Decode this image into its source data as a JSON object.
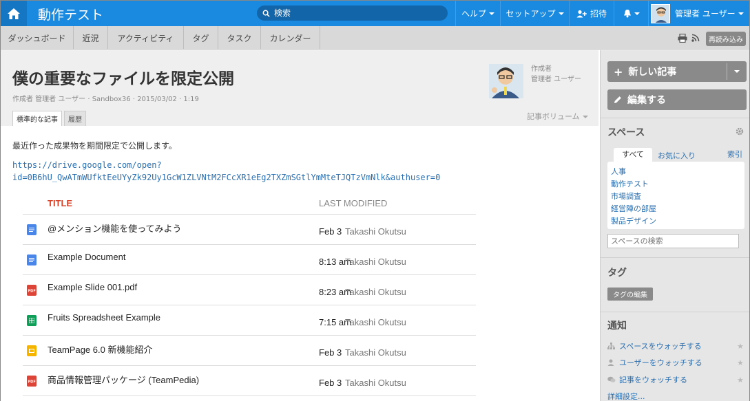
{
  "header": {
    "app_title": "動作テスト",
    "search_placeholder": "検索",
    "help": "ヘルプ",
    "setup": "セットアップ",
    "invite": "招待",
    "user": "管理者 ユーザー"
  },
  "tabs": [
    "ダッシュボード",
    "近況",
    "アクティビティ",
    "タグ",
    "タスク",
    "カレンダー"
  ],
  "reload_label": "再読み込み",
  "article": {
    "title": "僕の重要なファイルを限定公開",
    "meta": "作成者 管理者 ユーザー · Sandbox36 · 2015/03/02 · 1:19",
    "author_label": "作成者",
    "author_name": "管理者 ユーザー",
    "tab_standard": "標準的な記事",
    "tab_history": "履歴",
    "volume_label": "記事ボリューム",
    "body": "最近作った成果物を期間限定で公開します。",
    "link_line1": "https://drive.google.com/open?",
    "link_line2": "id=0B6hU_QwATmWUfktEeUYyZk92Uy1GcW1ZLVNtM2FCcXR1eEg2TXZmSGtlYmMteTJQTzVmNlk&authuser=0"
  },
  "files": {
    "col_title": "TITLE",
    "col_modified": "LAST MODIFIED",
    "rows": [
      {
        "name": "@メンション機能を使ってみよう",
        "date": "Feb 3",
        "user": "Takashi Okutsu",
        "type": "doc"
      },
      {
        "name": "Example Document",
        "date": "8:13 am",
        "user": "Takashi Okutsu",
        "type": "doc"
      },
      {
        "name": "Example Slide 001.pdf",
        "date": "8:23 am",
        "user": "Takashi Okutsu",
        "type": "pdf"
      },
      {
        "name": "Fruits Spreadsheet Example",
        "date": "7:15 am",
        "user": "Takashi Okutsu",
        "type": "sheet"
      },
      {
        "name": "TeamPage 6.0 新機能紹介",
        "date": "Feb 3",
        "user": "Takashi Okutsu",
        "type": "slides"
      },
      {
        "name": "商品情報管理パッケージ (TeamPedia)",
        "date": "Feb 3",
        "user": "Takashi Okutsu",
        "type": "pdf"
      }
    ]
  },
  "sidebar": {
    "new_post": "新しい記事",
    "edit": "編集する",
    "spaces_title": "スペース",
    "tab_all": "すべて",
    "tab_fav": "お気に入り",
    "tab_index": "索引",
    "spaces": [
      "人事",
      "動作テスト",
      "市場調査",
      "経営陣の部屋",
      "製品デザイン"
    ],
    "space_search_placeholder": "スペースの検索",
    "tags_title": "タグ",
    "tag_edit": "タグの編集",
    "notify_title": "通知",
    "watch_space": "スペースをウォッチする",
    "watch_user": "ユーザーをウォッチする",
    "watch_post": "記事をウォッチする",
    "advanced": "詳細設定..."
  },
  "colors": {
    "header_blue": "#1a8ae0",
    "link_blue": "#2a6fb0",
    "title_red": "#d9442b"
  }
}
